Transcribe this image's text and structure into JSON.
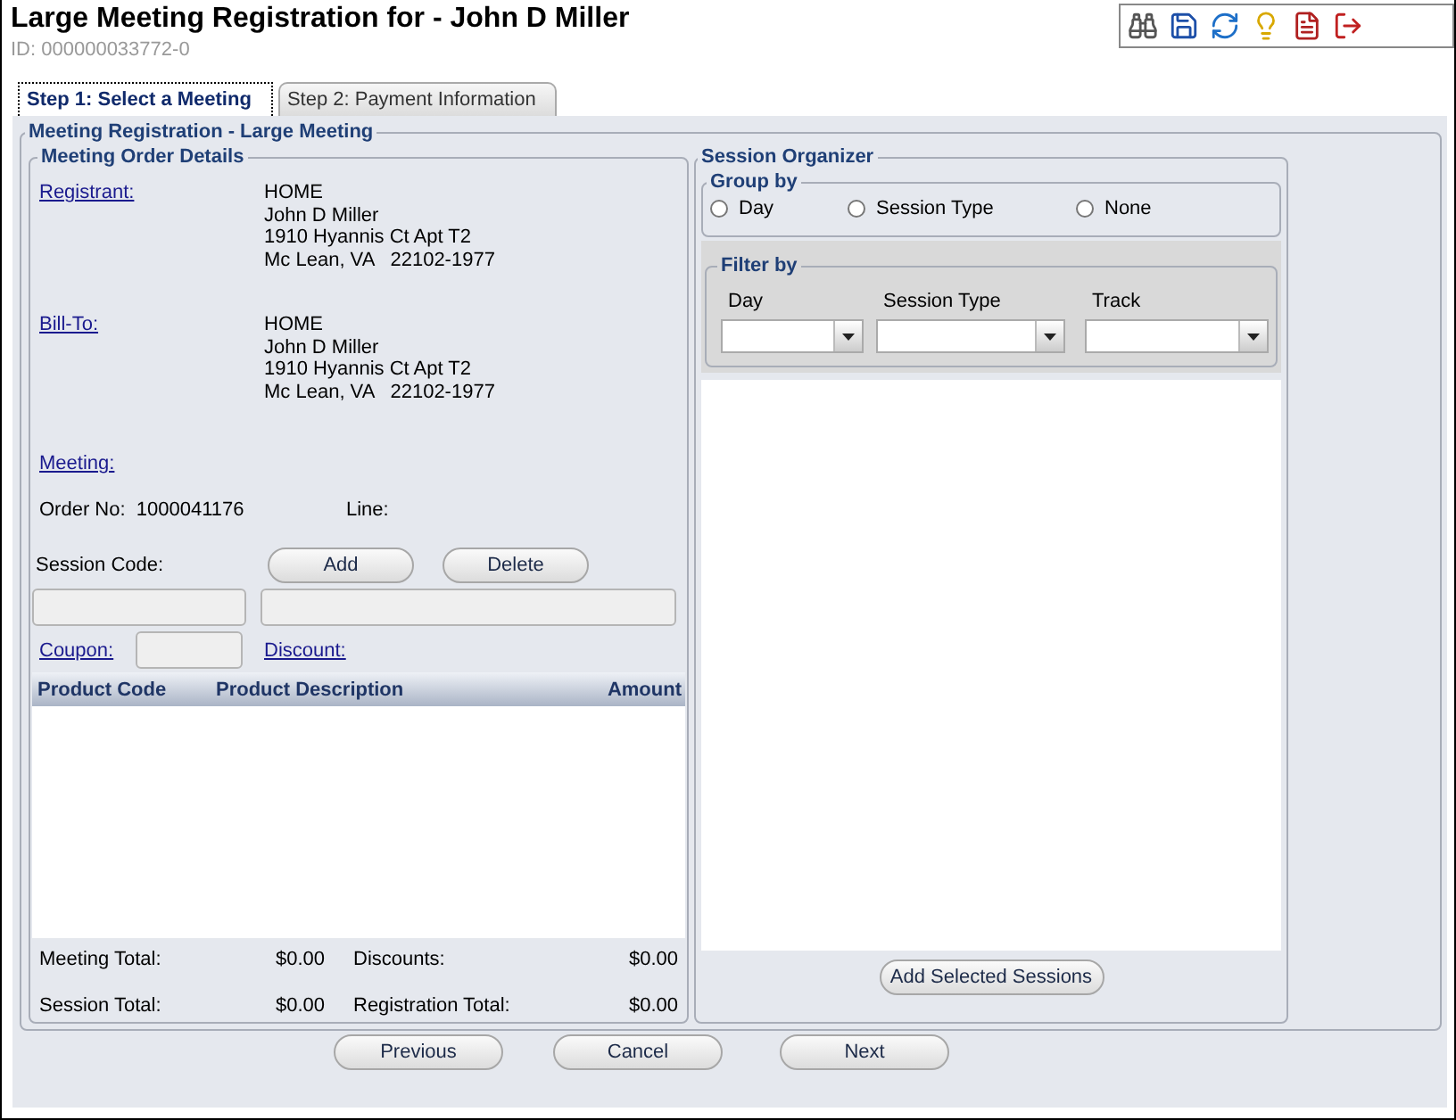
{
  "header": {
    "title": "Large Meeting Registration for - John D Miller",
    "id": "ID: 000000033772-0"
  },
  "tabs": [
    {
      "label": "Step 1: Select a Meeting",
      "selected": true
    },
    {
      "label": "Step 2: Payment Information",
      "selected": false
    }
  ],
  "registration": {
    "legend": "Meeting Registration - Large Meeting"
  },
  "order_details": {
    "legend": "Meeting Order Details",
    "addresses": [
      {
        "label": "Registrant:",
        "lines": [
          "HOME",
          "John D Miller",
          "1910 Hyannis Ct Apt T2",
          "Mc Lean, VA   22102-1977"
        ]
      },
      {
        "label": "Bill-To:",
        "lines": [
          "HOME",
          "John D Miller",
          "1910 Hyannis Ct Apt T2",
          "Mc Lean, VA   22102-1977"
        ]
      }
    ],
    "meeting_link": "Meeting:",
    "order_no_label": "Order No:",
    "order_no": "1000041176",
    "line_label": "Line:",
    "session_code_label": "Session Code:",
    "buttons": [
      "Add",
      "Delete"
    ],
    "coupon_link": "Coupon:",
    "discount_link": "Discount:",
    "columns": [
      "Product Code",
      "Product Description",
      "Amount"
    ],
    "totals": [
      {
        "label": "Meeting Total:",
        "value": "$0.00"
      },
      {
        "label": "Discounts:",
        "value": "$0.00"
      },
      {
        "label": "Session Total:",
        "value": "$0.00"
      },
      {
        "label": "Registration Total:",
        "value": "$0.00"
      }
    ]
  },
  "session_organizer": {
    "legend": "Session Organizer",
    "group_by": {
      "legend": "Group by",
      "options": [
        {
          "label": "Day",
          "selected": false
        },
        {
          "label": "Session Type",
          "selected": false
        },
        {
          "label": "None",
          "selected": false
        }
      ]
    },
    "filter_by": {
      "legend": "Filter by",
      "filters": [
        {
          "label": "Day"
        },
        {
          "label": "Session Type"
        },
        {
          "label": "Track"
        }
      ]
    },
    "button": "Add Selected Sessions"
  },
  "nav_buttons": [
    "Previous",
    "Cancel",
    "Next"
  ]
}
